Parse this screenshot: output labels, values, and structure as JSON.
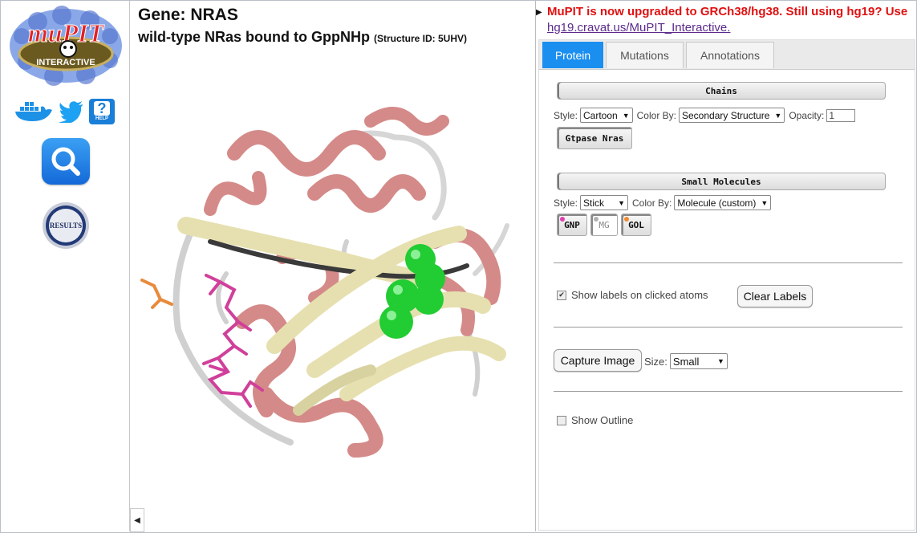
{
  "sidebar": {
    "logo_text": "muPIT",
    "logo_sub": "INTERACTIVE",
    "help_label": "HELP",
    "results_label": "RESULTS"
  },
  "viewer": {
    "gene_title": "Gene: NRAS",
    "subtitle": "wild-type NRas bound to GppNHp",
    "structure_id": "(Structure ID: 5UHV)"
  },
  "notice": {
    "text": "MuPIT is now upgraded to GRCh38/hg38. Still using hg19? Use",
    "link": "hg19.cravat.us/MuPIT_Interactive."
  },
  "tabs": [
    {
      "label": "Protein",
      "active": true
    },
    {
      "label": "Mutations",
      "active": false
    },
    {
      "label": "Annotations",
      "active": false
    }
  ],
  "chains": {
    "header": "Chains",
    "style_label": "Style:",
    "style_value": "Cartoon",
    "color_label": "Color By:",
    "color_value": "Secondary Structure",
    "opacity_label": "Opacity:",
    "opacity_value": "1",
    "chain_button": "Gtpase Nras"
  },
  "small_molecules": {
    "header": "Small Molecules",
    "style_label": "Style:",
    "style_value": "Stick",
    "color_label": "Color By:",
    "color_value": "Molecule (custom)",
    "molecules": [
      {
        "label": "GNP",
        "color": "#e040b0"
      },
      {
        "label": "MG",
        "color": "#b0b0b0"
      },
      {
        "label": "GOL",
        "color": "#f08a30"
      }
    ]
  },
  "labels": {
    "show_labels_text": "Show labels on clicked atoms",
    "show_labels_checked": true,
    "clear_labels": "Clear Labels"
  },
  "capture": {
    "button": "Capture Image",
    "size_label": "Size:",
    "size_value": "Small"
  },
  "outline": {
    "text": "Show Outline",
    "checked": false
  },
  "colors": {
    "helix": "#d48a88",
    "sheet": "#e6e0b0",
    "coil": "#e8e8e8",
    "ligand_gnp": "#d0409a",
    "ligand_gol": "#e88a3c",
    "ions": "#22cc33",
    "tab_active": "#1a8ff0",
    "notice_red": "#e01010"
  }
}
